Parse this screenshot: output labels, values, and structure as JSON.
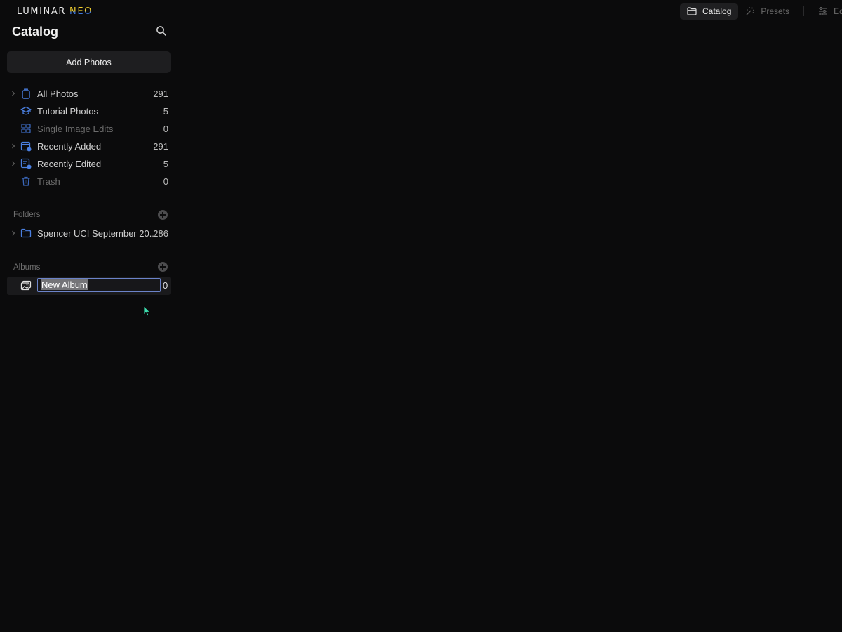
{
  "app": {
    "logo_main": "LUMINAR",
    "logo_accent": "NEO"
  },
  "topnav": {
    "tabs": [
      {
        "label": "Catalog",
        "icon": "folder-icon",
        "active": true
      },
      {
        "label": "Presets",
        "icon": "sparkle-icon",
        "active": false
      },
      {
        "label": "Edi",
        "icon": "sliders-icon",
        "active": false
      }
    ]
  },
  "sidebar": {
    "title": "Catalog",
    "add_photos_label": "Add Photos",
    "items": [
      {
        "label": "All Photos",
        "count": "291",
        "icon": "photos-stack-icon",
        "expandable": true,
        "dim": false
      },
      {
        "label": "Tutorial Photos",
        "count": "5",
        "icon": "graduation-cap-icon",
        "expandable": false,
        "dim": false
      },
      {
        "label": "Single Image Edits",
        "count": "0",
        "icon": "grid-icon",
        "expandable": false,
        "dim": true
      },
      {
        "label": "Recently Added",
        "count": "291",
        "icon": "calendar-added-icon",
        "expandable": true,
        "dim": false
      },
      {
        "label": "Recently Edited",
        "count": "5",
        "icon": "document-edited-icon",
        "expandable": true,
        "dim": false
      },
      {
        "label": "Trash",
        "count": "0",
        "icon": "trash-icon",
        "expandable": false,
        "dim": true
      }
    ],
    "folders": {
      "label": "Folders",
      "items": [
        {
          "label": "Spencer UCI September 20...",
          "count": "286",
          "icon": "folder-icon",
          "expandable": true
        }
      ]
    },
    "albums": {
      "label": "Albums",
      "items": [
        {
          "value": "New Album",
          "count": "0",
          "icon": "album-icon",
          "editing": true
        }
      ]
    }
  },
  "colors": {
    "background": "#0b0b0c",
    "accent_blue": "#4a7fe0",
    "input_border": "#6b83c9",
    "cursor": "#3ee0b0"
  }
}
